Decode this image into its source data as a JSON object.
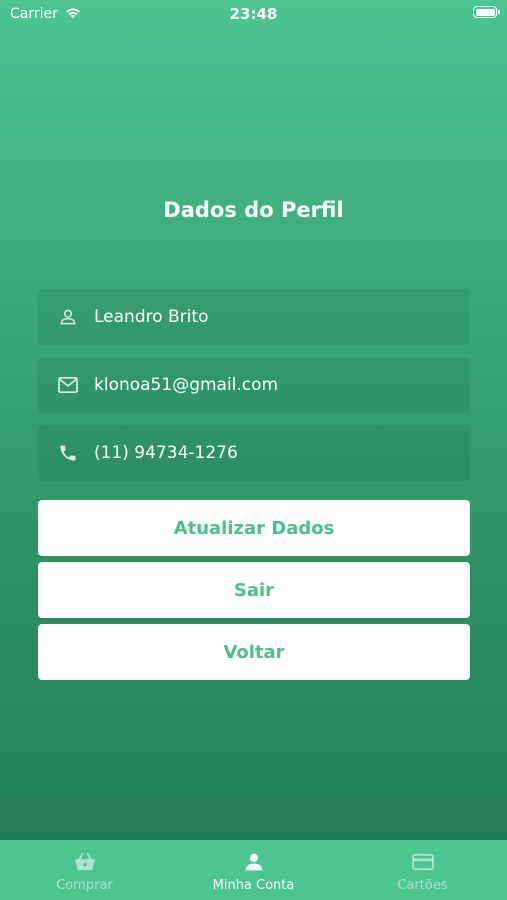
{
  "status_bar": {
    "carrier": "Carrier",
    "time": "23:48"
  },
  "page": {
    "title": "Dados do Perfil"
  },
  "profile": {
    "name": "Leandro Brito",
    "email": "klonoa51@gmail.com",
    "phone": "(11) 94734-1276"
  },
  "buttons": {
    "update": "Atualizar Dados",
    "logout": "Sair",
    "back": "Voltar"
  },
  "tab_bar": {
    "tabs": [
      {
        "label": "Comprar",
        "icon": "basket-icon",
        "active": false
      },
      {
        "label": "Minha Conta",
        "icon": "person-icon",
        "active": true
      },
      {
        "label": "Cartões",
        "icon": "card-icon",
        "active": false
      }
    ]
  },
  "colors": {
    "gradient_top": "#4cc58f",
    "gradient_bottom": "#207a51",
    "button_text": "#4cc08a",
    "tab_bar": "#4cc58f"
  }
}
